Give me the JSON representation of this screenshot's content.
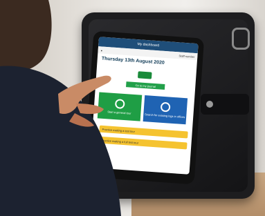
{
  "app": {
    "header_title": "My dashboard",
    "staff_label": "Staff number",
    "date": "Thursday 13th August 2020",
    "journey_button": "Go to my journal",
    "tile_left": "Start a general tour",
    "tile_right": "Search for existing logs in offices",
    "bar1": "Practice making a test tour",
    "bar2": "Practice making a full test tour"
  }
}
